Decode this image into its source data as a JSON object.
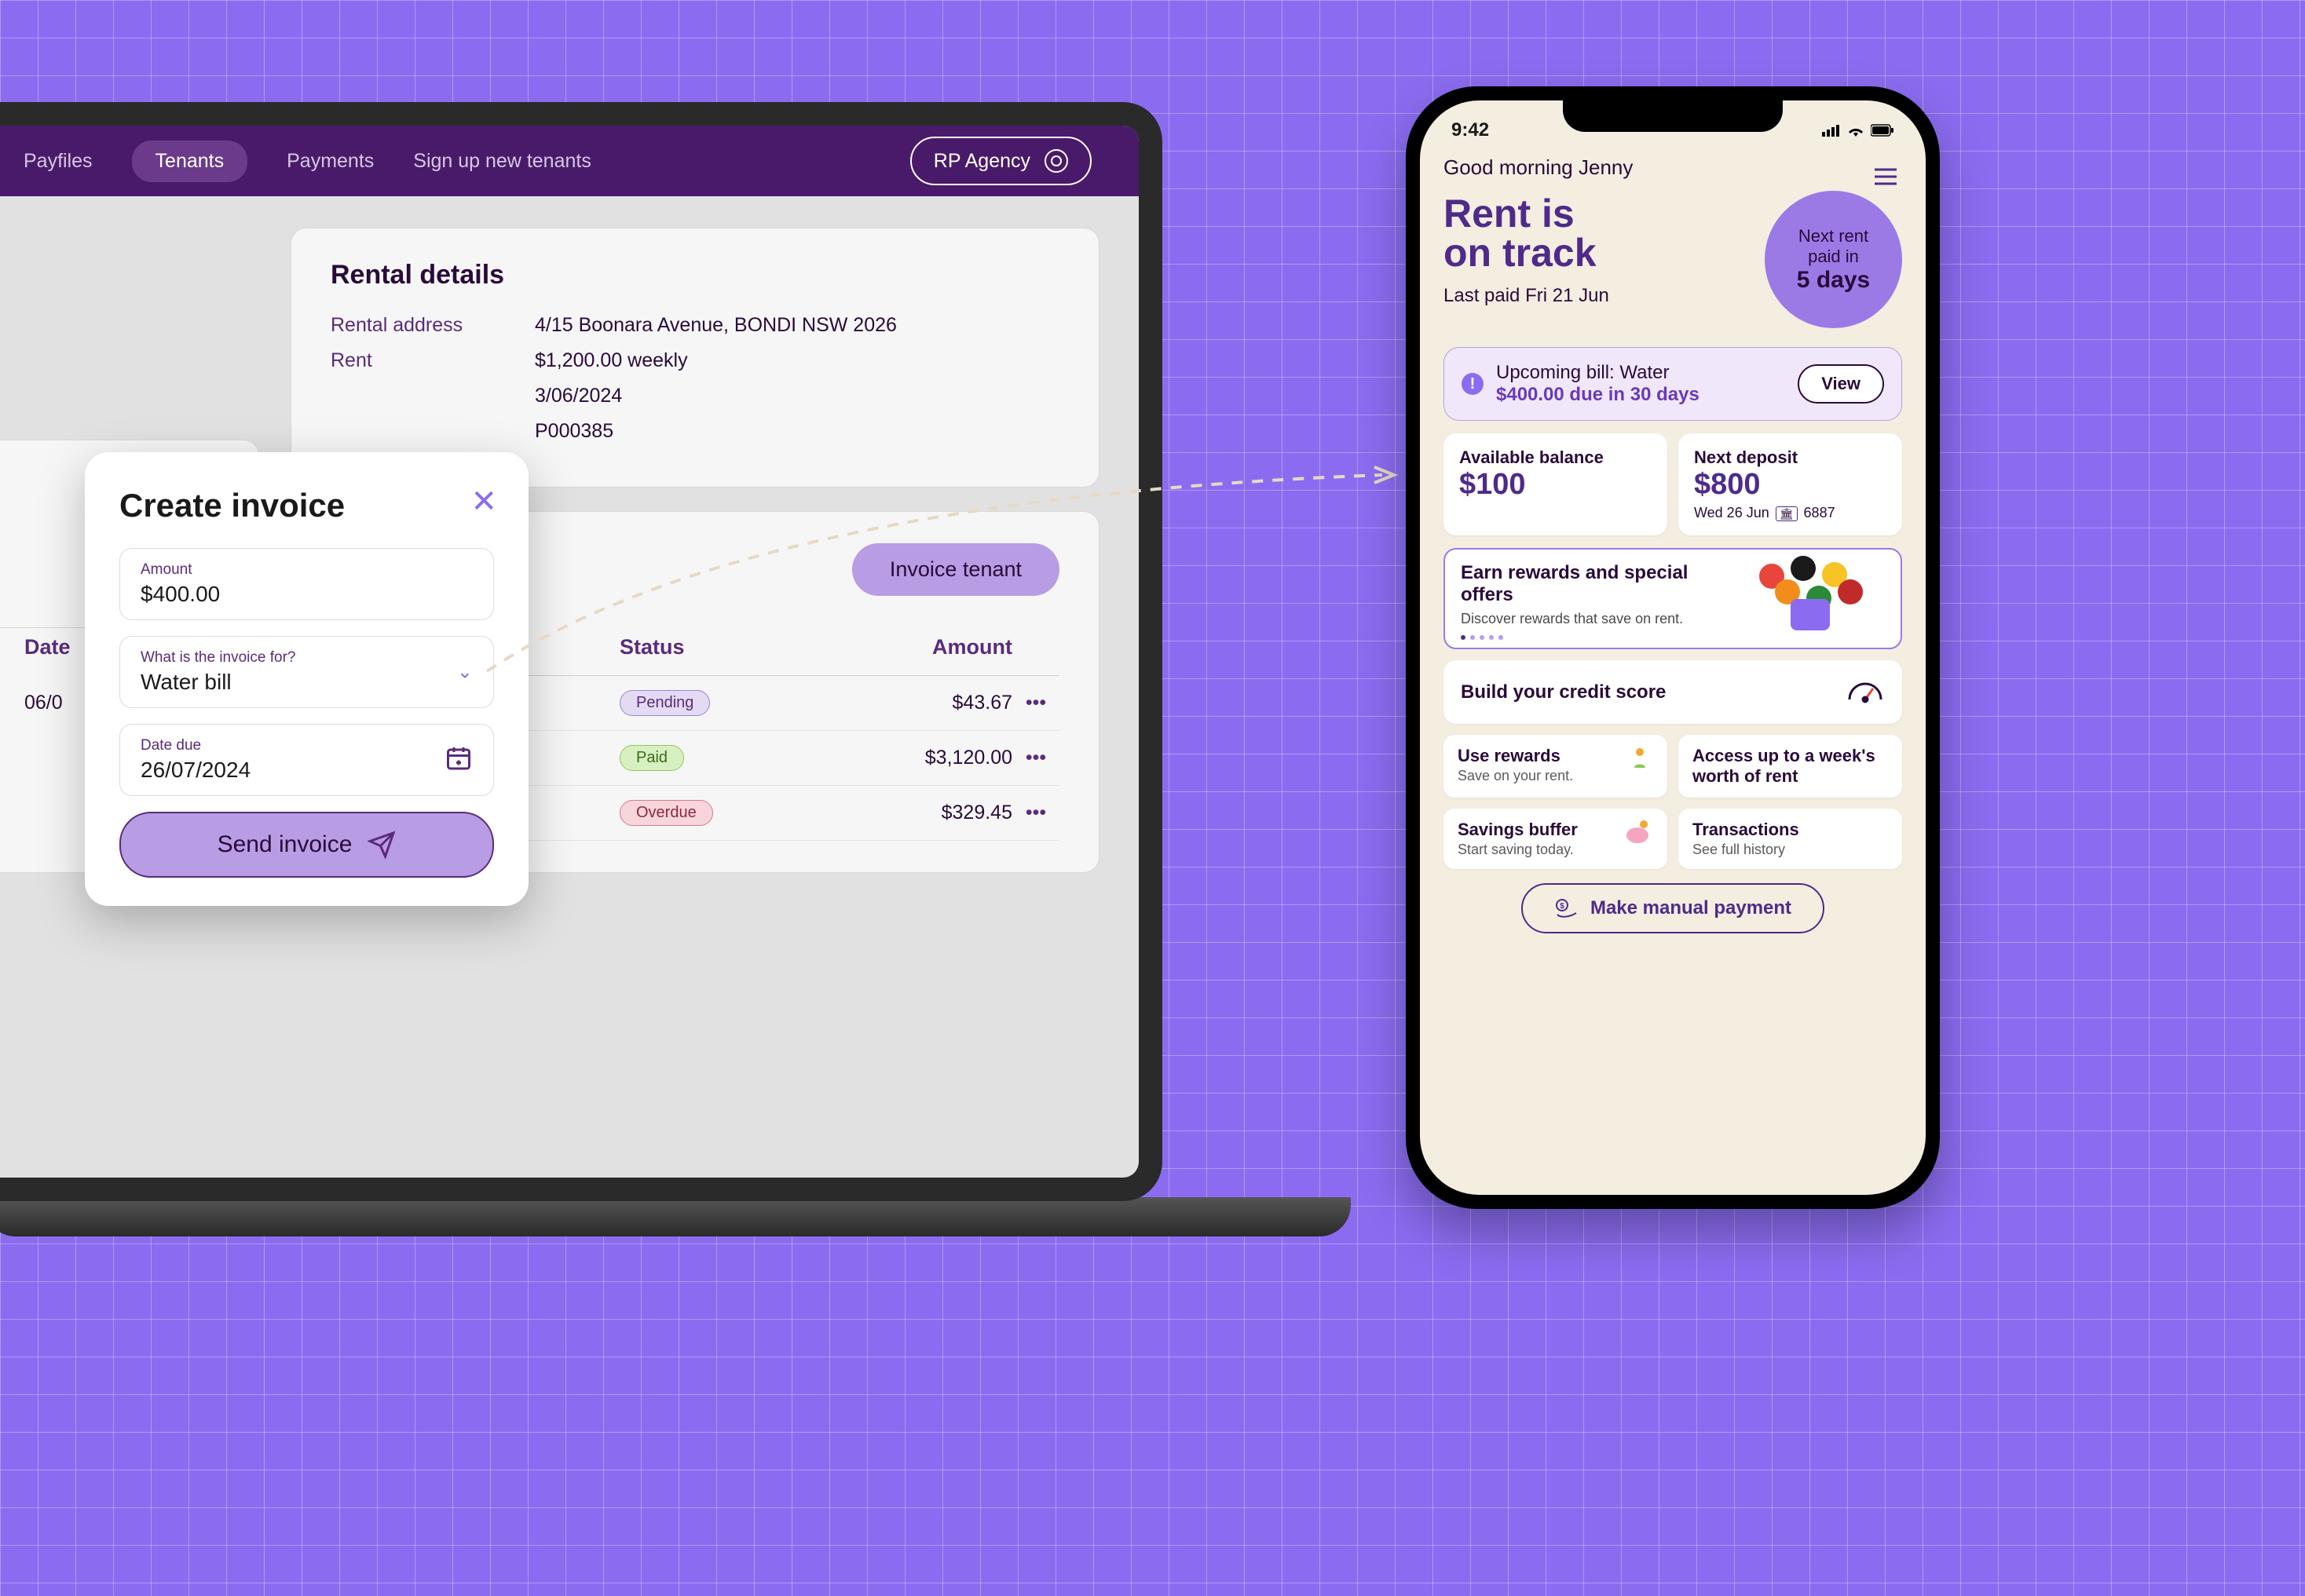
{
  "desktop": {
    "nav": {
      "payfiles": "Payfiles",
      "tenants": "Tenants",
      "payments": "Payments",
      "signup": "Sign up new tenants",
      "agency": "RP Agency"
    },
    "panel_title": "Rental details",
    "details": {
      "addr_label": "Rental address",
      "addr_value": "4/15 Boonara Avenue, BONDI NSW 2026",
      "rent_label": "Rent",
      "rent_value": "$1,200.00  weekly",
      "date_label": "",
      "date_value": "3/06/2024",
      "ref_value": "P000385"
    },
    "invoice_btn": "Invoice tenant",
    "headers": {
      "date": "Date",
      "status": "Status",
      "amount": "Amount"
    },
    "rows": [
      {
        "date": "06/0",
        "status": "Pending",
        "status_cls": "pending",
        "amount": "$43.67"
      },
      {
        "date": "",
        "status": "Paid",
        "status_cls": "paid",
        "amount": "$3,120.00"
      },
      {
        "date": "",
        "status": "Overdue",
        "status_cls": "overdue",
        "amount": "$329.45"
      }
    ]
  },
  "modal": {
    "title": "Create invoice",
    "amount_label": "Amount",
    "amount_value": "$400.00",
    "for_label": "What is the invoice for?",
    "for_value": "Water bill",
    "due_label": "Date due",
    "due_value": "26/07/2024",
    "send": "Send invoice"
  },
  "phone": {
    "time": "9:42",
    "greeting": "Good morning Jenny",
    "hero_l1": "Rent is",
    "hero_l2": "on track",
    "hero_sub": "Last paid Fri 21 Jun",
    "circle_l1": "Next rent",
    "circle_l2": "paid in",
    "circle_b": "5 days",
    "alert_l1": "Upcoming bill: Water",
    "alert_l2": "$400.00 due in 30 days",
    "view": "View",
    "bal_label": "Available balance",
    "bal_val": "$100",
    "dep_label": "Next deposit",
    "dep_val": "$800",
    "dep_sub1": "Wed 26 Jun",
    "dep_sub2": "6887",
    "promo_t": "Earn rewards and special offers",
    "promo_s": "Discover rewards that save on rent.",
    "credit": "Build your credit score",
    "rewards_t": "Use rewards",
    "rewards_s": "Save on your rent.",
    "access_t": "Access up to a week's worth of rent",
    "buffer_t": "Savings buffer",
    "buffer_s": "Start saving today.",
    "trans_t": "Transactions",
    "trans_s": "See full history",
    "manual": "Make manual payment"
  }
}
